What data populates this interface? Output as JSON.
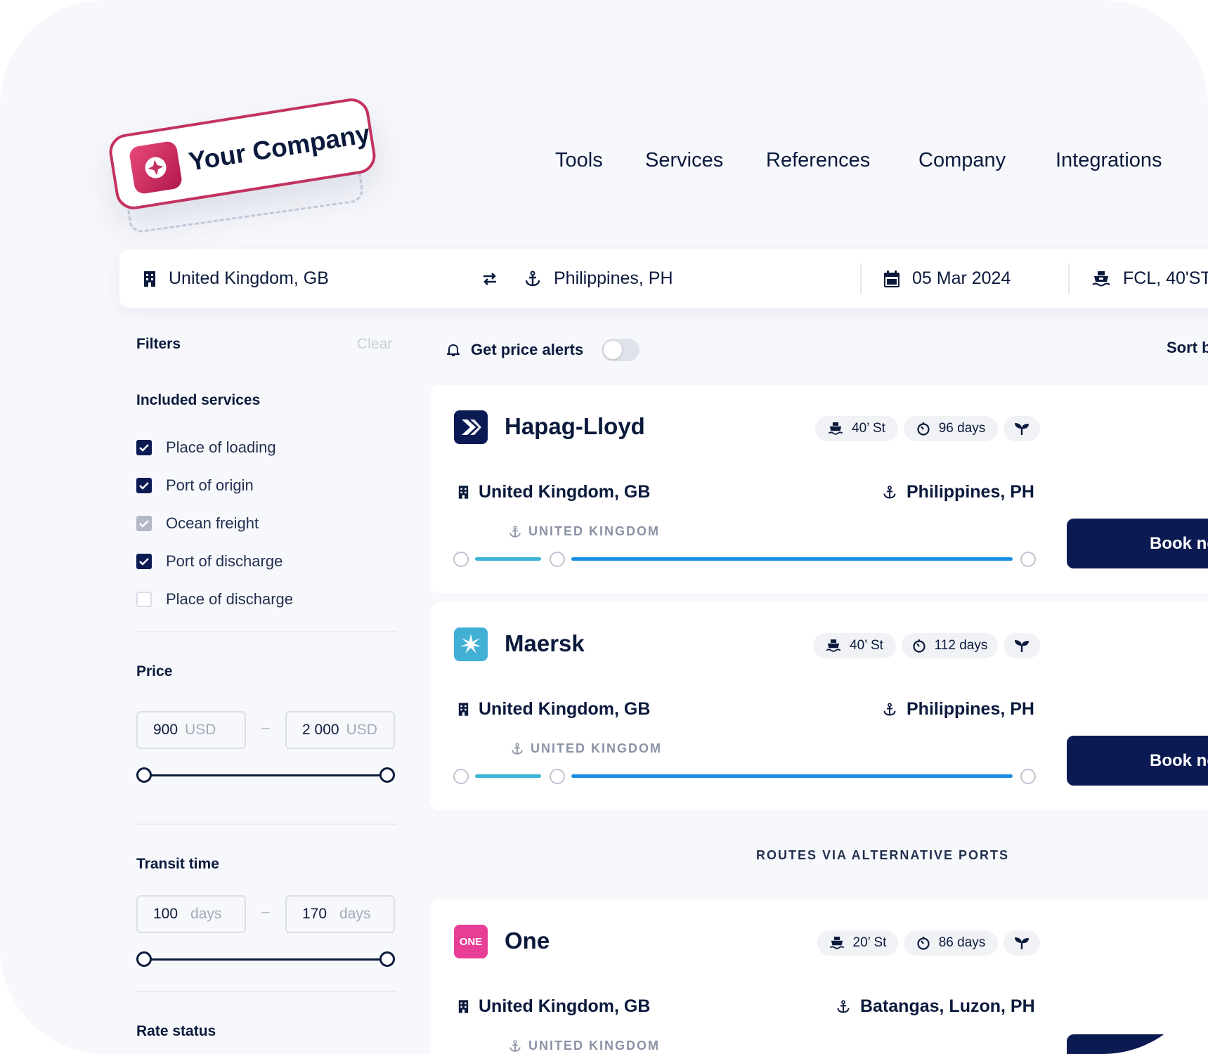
{
  "brand": {
    "name": "Your Company",
    "logo_icon": "sparkle-star-icon",
    "accent": "#c3325f"
  },
  "nav": {
    "items": [
      "Tools",
      "Services",
      "References",
      "Company",
      "Integrations"
    ]
  },
  "search": {
    "origin": "United Kingdom, GB",
    "destination": "Philippines, PH",
    "date": "05 Mar 2024",
    "container": "FCL, 40'ST"
  },
  "filters": {
    "title": "Filters",
    "clear": "Clear",
    "services_title": "Included services",
    "services": [
      {
        "label": "Place of loading",
        "state": "checked"
      },
      {
        "label": "Port of origin",
        "state": "checked"
      },
      {
        "label": "Ocean freight",
        "state": "locked"
      },
      {
        "label": "Port of discharge",
        "state": "checked"
      },
      {
        "label": "Place of discharge",
        "state": "unchecked"
      }
    ],
    "price_title": "Price",
    "price_min": "900",
    "price_min_unit": "USD",
    "price_max": "2 000",
    "price_max_unit": "USD",
    "transit_title": "Transit time",
    "transit_min": "100",
    "transit_min_unit": "days",
    "transit_max": "170",
    "transit_max_unit": "days",
    "rate_title": "Rate status",
    "range_separator": "–"
  },
  "results": {
    "alerts_label": "Get price alerts",
    "sort_label": "Sort b",
    "alt_ports_label": "ROUTES VIA ALTERNATIVE PORTS",
    "cards": [
      {
        "carrier": "Hapag-Lloyd",
        "container": "40’ St",
        "transit": "96 days",
        "from": "United Kingdom, GB",
        "to": "Philippines, PH",
        "via": "UNITED KINGDOM",
        "book": "Book no"
      },
      {
        "carrier": "Maersk",
        "container": "40’ St",
        "transit": "112 days",
        "from": "United Kingdom, GB",
        "to": "Philippines, PH",
        "via": "UNITED KINGDOM",
        "book": "Book no"
      },
      {
        "carrier": "One",
        "logo_text": "ONE",
        "container": "20’ St",
        "transit": "86 days",
        "from": "United Kingdom, GB",
        "to": "Batangas, Luzon, PH",
        "via": "UNITED KINGDOM"
      }
    ]
  },
  "colors": {
    "navy": "#0b1a52",
    "route_blue": "#1a8fe3",
    "route_teal": "#3cb4d6",
    "maersk": "#42b0d5",
    "one": "#e83e96",
    "hapag": "#0b1a52"
  }
}
